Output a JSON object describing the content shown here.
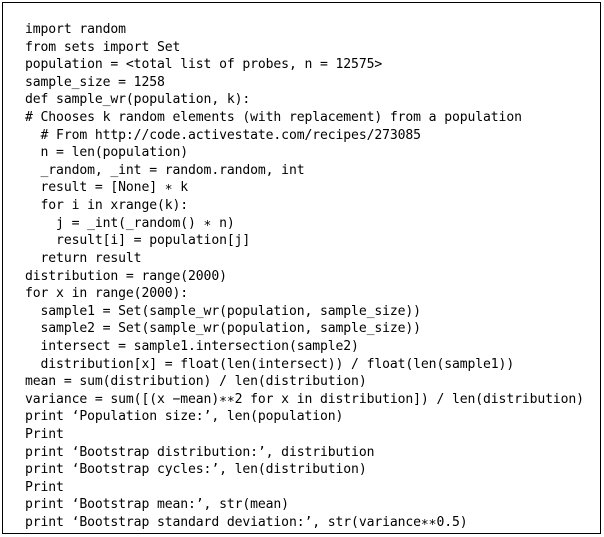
{
  "figure": {
    "kind": "code-listing",
    "language": "python",
    "border_color": "#000000",
    "background_color": "#ffffff",
    "text_color": "#000000",
    "total_lines": 27
  },
  "code": {
    "lines": [
      "import random",
      "from sets import Set",
      "population = <total list of probes, n = 12575>",
      "sample_size = 1258",
      "def sample_wr(population, k):",
      "# Chooses k random elements (with replacement) from a population",
      "  # From http://code.activestate.com/recipes/273085",
      "  n = len(population)",
      "  _random, _int = random.random, int",
      "  result = [None] ∗ k",
      "  for i in xrange(k):",
      "    j = _int(_random() ∗ n)",
      "    result[i] = population[j]",
      "  return result",
      "distribution = range(2000)",
      "for x in range(2000):",
      "  sample1 = Set(sample_wr(population, sample_size))",
      "  sample2 = Set(sample_wr(population, sample_size))",
      "  intersect = sample1.intersection(sample2)",
      "  distribution[x] = float(len(intersect)) / float(len(sample1))",
      "mean = sum(distribution) / len(distribution)",
      "variance = sum([(x −mean)∗∗2 for x in distribution]) / len(distribution)",
      "print ‘Population size:’, len(population)",
      "Print",
      "print ‘Bootstrap distribution:’, distribution",
      "print ‘Bootstrap cycles:’, len(distribution)",
      "Print",
      "print ‘Bootstrap mean:’, str(mean)",
      "print ‘Bootstrap standard deviation:’, str(variance∗∗0.5)"
    ]
  }
}
